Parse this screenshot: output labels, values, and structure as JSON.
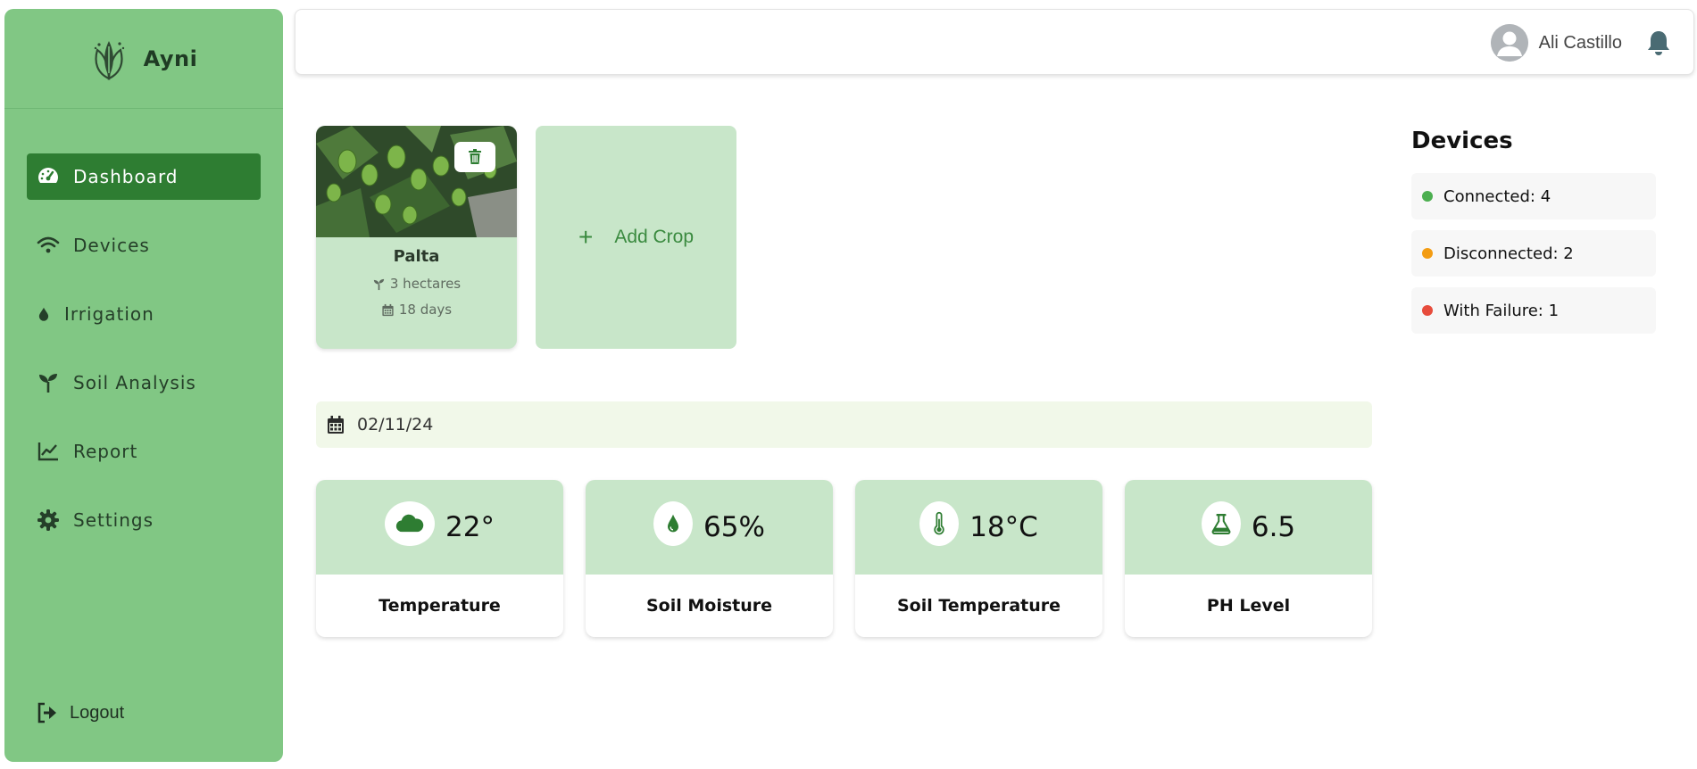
{
  "brand": {
    "name": "Ayni"
  },
  "sidebar": {
    "items": [
      {
        "label": "Dashboard",
        "icon": "gauge-icon",
        "active": true
      },
      {
        "label": "Devices",
        "icon": "wifi-icon",
        "active": false
      },
      {
        "label": "Irrigation",
        "icon": "droplet-icon",
        "active": false
      },
      {
        "label": "Soil Analysis",
        "icon": "seedling-icon",
        "active": false
      },
      {
        "label": "Report",
        "icon": "chart-line-icon",
        "active": false
      },
      {
        "label": "Settings",
        "icon": "gear-icon",
        "active": false
      }
    ],
    "logout_label": "Logout"
  },
  "header": {
    "user_name": "Ali Castillo"
  },
  "crops": [
    {
      "name": "Palta",
      "area": "3 hectares",
      "duration": "18 days"
    }
  ],
  "add_crop_label": "Add Crop",
  "date": "02/11/24",
  "metrics": [
    {
      "value": "22°",
      "label": "Temperature",
      "icon": "cloud-icon"
    },
    {
      "value": "65%",
      "label": "Soil Moisture",
      "icon": "droplet-icon"
    },
    {
      "value": "18°C",
      "label": "Soil Temperature",
      "icon": "thermometer-icon"
    },
    {
      "value": "6.5",
      "label": "PH Level",
      "icon": "flask-icon"
    }
  ],
  "devices": {
    "title": "Devices",
    "statuses": [
      {
        "label": "Connected: 4",
        "color": "#4caf50"
      },
      {
        "label": "Disconnected: 2",
        "color": "#f39c12"
      },
      {
        "label": "With Failure: 1",
        "color": "#e74c3c"
      }
    ]
  },
  "colors": {
    "sidebar": "#81c784",
    "active": "#2e7d32",
    "card": "#c8e6c9",
    "accent": "#3a8a3f"
  }
}
